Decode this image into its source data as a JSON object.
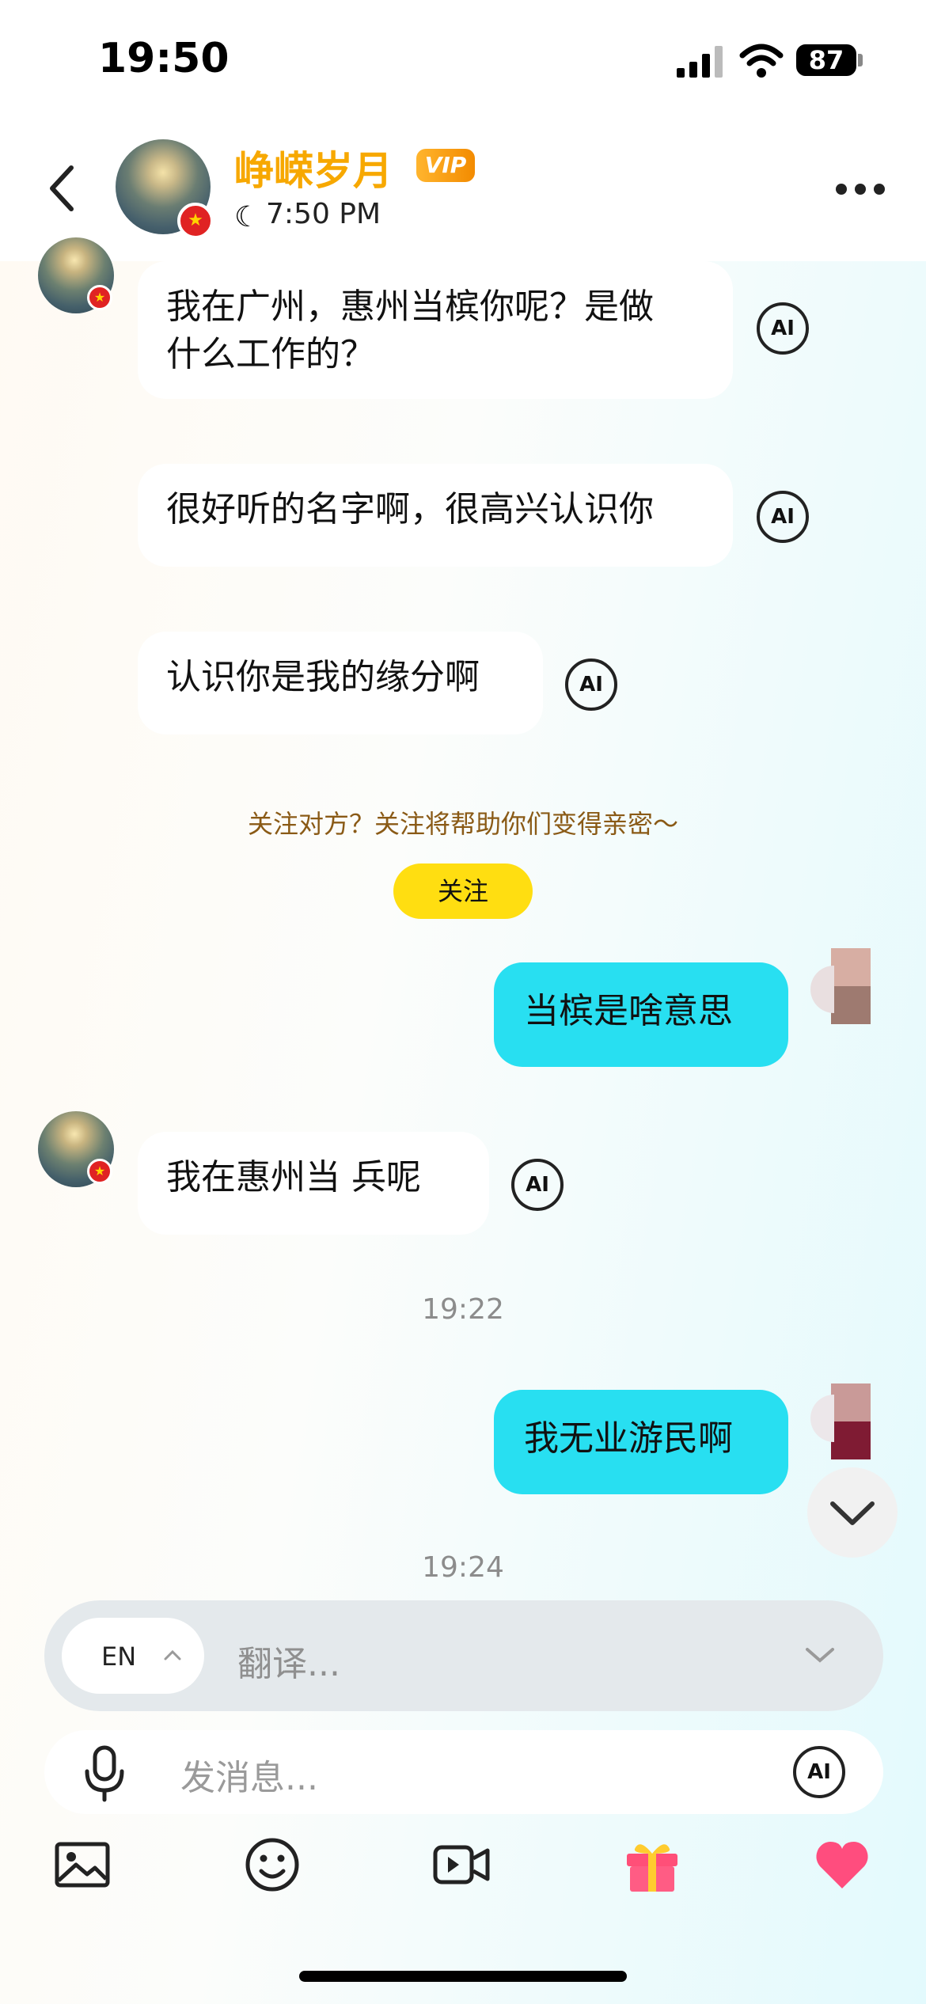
{
  "status_bar": {
    "time": "19:50",
    "battery": "87"
  },
  "header": {
    "contact_name": "峥嵘岁月",
    "vip_label": "VIP",
    "local_time": "7:50 PM"
  },
  "messages": [
    {
      "from": "them",
      "text_line1": "我在广州，惠州当槟你呢？是做",
      "text_line2": "什么工作的？"
    },
    {
      "from": "them",
      "text": "很好听的名字啊，很高兴认识你"
    },
    {
      "from": "them",
      "text": "认识你是我的缘分啊"
    },
    {
      "from": "me",
      "text": "当槟是啥意思"
    },
    {
      "from": "them",
      "text": "我在惠州当  兵呢"
    },
    {
      "from": "me",
      "text": "我无业游民啊"
    }
  ],
  "ai_label": "AI",
  "follow": {
    "prompt": "关注对方？关注将帮助你们变得亲密～",
    "button_label": "关注"
  },
  "timestamps": [
    "19:22",
    "19:24"
  ],
  "translate": {
    "language": "EN",
    "placeholder": "翻译..."
  },
  "composer": {
    "placeholder": "发消息..."
  },
  "toolbar": [
    "image-icon",
    "emoji-icon",
    "video-call-icon",
    "gift-icon",
    "heart-icon"
  ],
  "colors": {
    "accent": "#28dff1",
    "name": "#f7a800",
    "follow_button": "#ffde11"
  }
}
